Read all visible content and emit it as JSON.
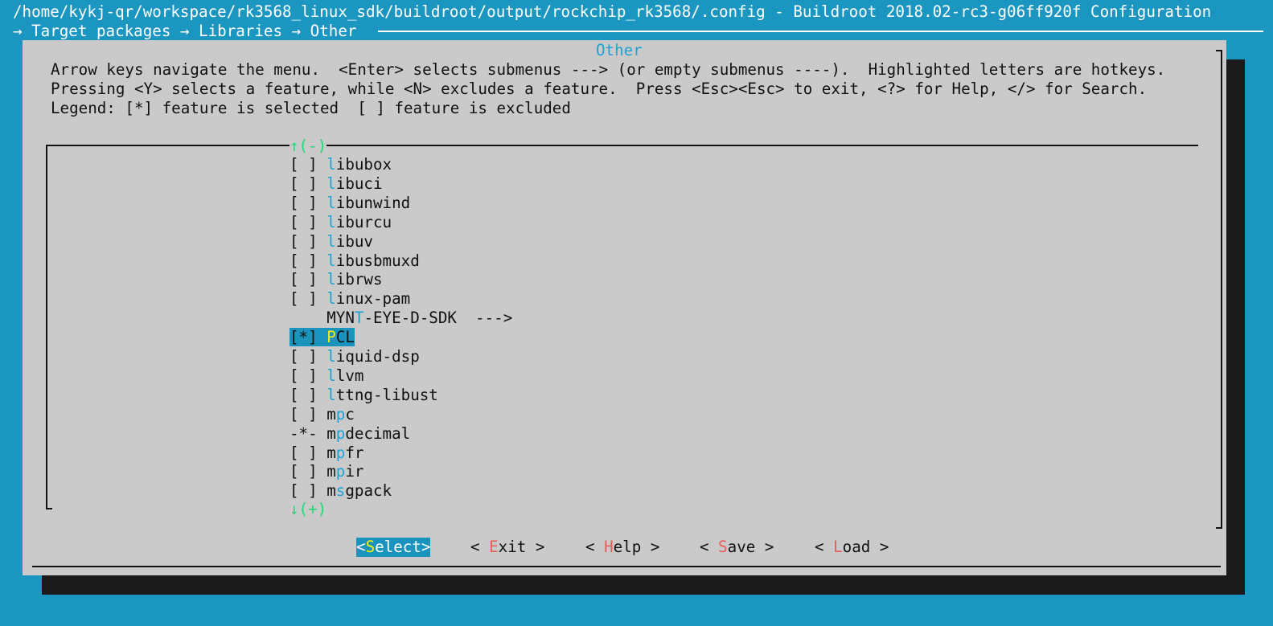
{
  "window": {
    "title": "/home/kykj-qr/workspace/rk3568_linux_sdk/buildroot/output/rockchip_rk3568/.config - Buildroot 2018.02-rc3-g06ff920f Configuration",
    "breadcrumb": "→ Target packages → Libraries → Other "
  },
  "dialog": {
    "title": "Other",
    "help": [
      "Arrow keys navigate the menu.  <Enter> selects submenus ---> (or empty submenus ----).  Highlighted letters are hotkeys.",
      "Pressing <Y> selects a feature, while <N> excludes a feature.  Press <Esc><Esc> to exit, <?> for Help, </> for Search.",
      "Legend: [*] feature is selected  [ ] feature is excluded"
    ],
    "scroll_up": "↑(-)",
    "scroll_down": "↓(+)"
  },
  "menu": [
    {
      "mark": "[ ]",
      "pre": "",
      "hot": "l",
      "post": "ibubox",
      "selected": false
    },
    {
      "mark": "[ ]",
      "pre": "",
      "hot": "l",
      "post": "ibuci",
      "selected": false
    },
    {
      "mark": "[ ]",
      "pre": "",
      "hot": "l",
      "post": "ibunwind",
      "selected": false
    },
    {
      "mark": "[ ]",
      "pre": "",
      "hot": "l",
      "post": "iburcu",
      "selected": false
    },
    {
      "mark": "[ ]",
      "pre": "",
      "hot": "l",
      "post": "ibuv",
      "selected": false
    },
    {
      "mark": "[ ]",
      "pre": "",
      "hot": "l",
      "post": "ibusbmuxd",
      "selected": false
    },
    {
      "mark": "[ ]",
      "pre": "",
      "hot": "l",
      "post": "ibrws",
      "selected": false
    },
    {
      "mark": "[ ]",
      "pre": "",
      "hot": "l",
      "post": "inux-pam",
      "selected": false
    },
    {
      "mark": "   ",
      "pre": "MYN",
      "hot": "T",
      "post": "-EYE-D-SDK  --->",
      "selected": false
    },
    {
      "mark": "[*]",
      "pre": "",
      "hot": "P",
      "post": "CL",
      "selected": true
    },
    {
      "mark": "[ ]",
      "pre": "",
      "hot": "l",
      "post": "iquid-dsp",
      "selected": false
    },
    {
      "mark": "[ ]",
      "pre": "",
      "hot": "l",
      "post": "lvm",
      "selected": false
    },
    {
      "mark": "[ ]",
      "pre": "",
      "hot": "l",
      "post": "ttng-libust",
      "selected": false
    },
    {
      "mark": "[ ]",
      "pre": "m",
      "hot": "p",
      "post": "c",
      "selected": false
    },
    {
      "mark": "-*-",
      "pre": "m",
      "hot": "p",
      "post": "decimal",
      "selected": false
    },
    {
      "mark": "[ ]",
      "pre": "m",
      "hot": "p",
      "post": "fr",
      "selected": false
    },
    {
      "mark": "[ ]",
      "pre": "m",
      "hot": "p",
      "post": "ir",
      "selected": false
    },
    {
      "mark": "[ ]",
      "pre": "m",
      "hot": "s",
      "post": "gpack",
      "selected": false
    }
  ],
  "buttons": [
    {
      "name": "select",
      "open": "<",
      "hot": "S",
      "rest": "elect",
      "close": ">",
      "selected": true
    },
    {
      "name": "exit",
      "open": "< ",
      "hot": "E",
      "rest": "xit",
      "close": " >",
      "selected": false
    },
    {
      "name": "help",
      "open": "< ",
      "hot": "H",
      "rest": "elp",
      "close": " >",
      "selected": false
    },
    {
      "name": "save",
      "open": "< ",
      "hot": "S",
      "rest": "ave",
      "close": " >",
      "selected": false
    },
    {
      "name": "load",
      "open": "< ",
      "hot": "L",
      "rest": "oad",
      "close": " >",
      "selected": false
    }
  ],
  "colors": {
    "background": "#1a96c0",
    "dialog": "#cacaca",
    "hotkey": "#1ea3d2",
    "selection": "#1a94bd",
    "selection_hotkey": "#f0f000",
    "button_hotkey": "#e85c5c",
    "scroll_arrow": "#20d77a"
  }
}
